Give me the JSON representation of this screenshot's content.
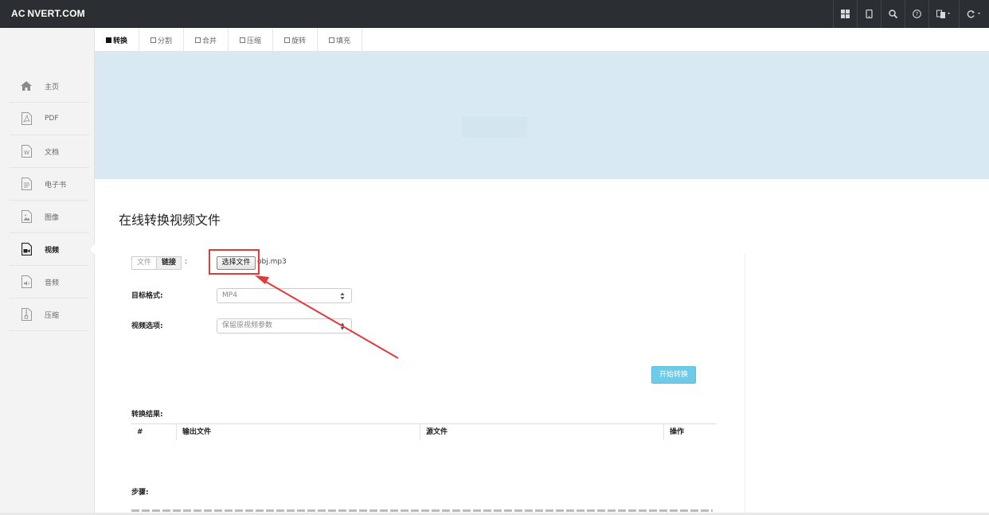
{
  "header": {
    "brand": "AC NVERT.COM",
    "icons": [
      "grid-icon",
      "tablet-icon",
      "search-icon",
      "help-icon",
      "language-icon",
      "refresh-icon"
    ]
  },
  "sidebar": {
    "items": [
      {
        "label": "主页",
        "icon": "home-icon"
      },
      {
        "label": "PDF",
        "icon": "pdf-icon"
      },
      {
        "label": "文档",
        "icon": "word-doc-icon"
      },
      {
        "label": "电子书",
        "icon": "ebook-icon"
      },
      {
        "label": "图像",
        "icon": "image-icon"
      },
      {
        "label": "视频",
        "icon": "video-icon",
        "active": true
      },
      {
        "label": "音频",
        "icon": "audio-icon"
      },
      {
        "label": "压缩",
        "icon": "archive-icon"
      }
    ]
  },
  "tabs": [
    {
      "label": "转换",
      "active": true
    },
    {
      "label": "分割"
    },
    {
      "label": "合并"
    },
    {
      "label": "压缩"
    },
    {
      "label": "旋转"
    },
    {
      "label": "填充"
    }
  ],
  "main": {
    "title": "在线转换视频文件",
    "source_toggle": {
      "file": "文件",
      "link": "链接"
    },
    "colon": ":",
    "choose_file_label": "选择文件",
    "file_name": "obj.mp3",
    "target_format_label": "目标格式:",
    "target_format_value": "MP4",
    "video_options_label": "视频选项:",
    "video_options_value": "保留原视频参数",
    "start_button": "开始转换",
    "results_label": "转换结果:",
    "results_columns": {
      "index": "#",
      "output": "输出文件",
      "source": "源文件",
      "action": "操作"
    },
    "steps_label": "步骤:"
  },
  "colors": {
    "topbar": "#2b2f33",
    "banner": "#d8e9f3",
    "start_button": "#6ccbe8",
    "annotation": "#e03a3a"
  }
}
